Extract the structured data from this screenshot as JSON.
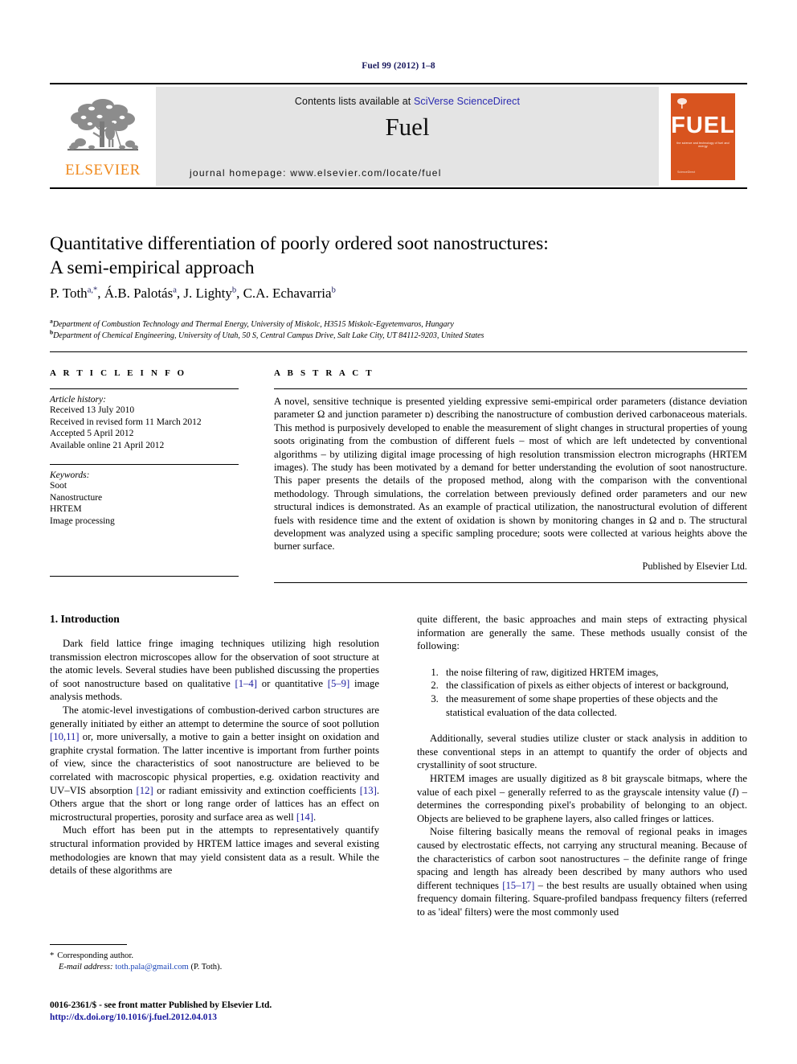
{
  "running_head": "Fuel 99 (2012) 1–8",
  "masthead": {
    "publisher_name": "ELSEVIER",
    "contents_prefix": "Contents lists available at ",
    "contents_link": "SciVerse ScienceDirect",
    "journal_name": "Fuel",
    "homepage": "journal homepage: www.elsevier.com/locate/fuel",
    "cover": {
      "title": "FUEL",
      "subtitle": "the science and technology of fuel and energy",
      "footer": "ScienceDirect"
    }
  },
  "article": {
    "title_line1": "Quantitative differentiation of poorly ordered soot nanostructures:",
    "title_line2": "A semi-empirical approach",
    "authors": [
      {
        "name": "P. Toth",
        "sup": "a,*"
      },
      {
        "name": "Á.B. Palotás",
        "sup": "a"
      },
      {
        "name": "J. Lighty",
        "sup": "b"
      },
      {
        "name": "C.A. Echavarria",
        "sup": "b"
      }
    ],
    "affiliations": [
      {
        "marker": "a",
        "text": "Department of Combustion Technology and Thermal Energy, University of Miskolc, H3515 Miskolc-Egyetemvaros, Hungary"
      },
      {
        "marker": "b",
        "text": "Department of Chemical Engineering, University of Utah, 50 S, Central Campus Drive, Salt Lake City, UT 84112-9203, United States"
      }
    ]
  },
  "info": {
    "label": "A R T I C L E    I N F O",
    "history_title": "Article history:",
    "history": [
      "Received 13 July 2010",
      "Received in revised form 11 March 2012",
      "Accepted 5 April 2012",
      "Available online 21 April 2012"
    ],
    "keywords_title": "Keywords:",
    "keywords": [
      "Soot",
      "Nanostructure",
      "HRTEM",
      "Image processing"
    ]
  },
  "abstract": {
    "label": "A B S T R A C T",
    "text": "A novel, sensitive technique is presented yielding expressive semi-empirical order parameters (distance deviation parameter Ω and junction parameter ᴅ) describing the nanostructure of combustion derived carbonaceous materials. This method is purposively developed to enable the measurement of slight changes in structural properties of young soots originating from the combustion of different fuels – most of which are left undetected by conventional algorithms – by utilizing digital image processing of high resolution transmission electron micrographs (HRTEM images). The study has been motivated by a demand for better understanding the evolution of soot nanostructure. This paper presents the details of the proposed method, along with the comparison with the conventional methodology. Through simulations, the correlation between previously defined order parameters and our new structural indices is demonstrated. As an example of practical utilization, the nanostructural evolution of different fuels with residence time and the extent of oxidation is shown by monitoring changes in Ω and ᴅ. The structural development was analyzed using a specific sampling procedure; soots were collected at various heights above the burner surface.",
    "published_by": "Published by Elsevier Ltd."
  },
  "body": {
    "section_heading": "1. Introduction",
    "left_paragraphs": [
      "Dark field lattice fringe imaging techniques utilizing high resolution transmission electron microscopes allow for the observation of soot structure at the atomic levels. Several studies have been published discussing the properties of soot nanostructure based on qualitative [1–4] or quantitative [5–9] image analysis methods.",
      "The atomic-level investigations of combustion-derived carbon structures are generally initiated by either an attempt to determine the source of soot pollution [10,11] or, more universally, a motive to gain a better insight on oxidation and graphite crystal formation. The latter incentive is important from further points of view, since the characteristics of soot nanostructure are believed to be correlated with macroscopic physical properties, e.g. oxidation reactivity and UV–VIS absorption [12] or radiant emissivity and extinction coefficients [13]. Others argue that the short or long range order of lattices has an effect on microstructural properties, porosity and surface area as well [14].",
      "Much effort has been put in the attempts to representatively quantify structural information provided by HRTEM lattice images and several existing methodologies are known that may yield consistent data as a result. While the details of these algorithms are"
    ],
    "right_intro_paragraph": "quite different, the basic approaches and main steps of extracting physical information are generally the same. These methods usually consist of the following:",
    "numbered_list": [
      "the noise filtering of raw, digitized HRTEM images,",
      "the classification of pixels as either objects of interest or background,",
      "the measurement of some shape properties of these objects and the statistical evaluation of the data collected."
    ],
    "right_paragraphs": [
      "Additionally, several studies utilize cluster or stack analysis in addition to these conventional steps in an attempt to quantify the order of objects and crystallinity of soot structure.",
      "HRTEM images are usually digitized as 8 bit grayscale bitmaps, where the value of each pixel – generally referred to as the grayscale intensity value (I) – determines the corresponding pixel's probability of belonging to an object. Objects are believed to be graphene layers, also called fringes or lattices.",
      "Noise filtering basically means the removal of regional peaks in images caused by electrostatic effects, not carrying any structural meaning. Because of the characteristics of carbon soot nanostructures – the definite range of fringe spacing and length has already been described by many authors who used different techniques [15–17] – the best results are usually obtained when using frequency domain filtering. Square-profiled bandpass frequency filters (referred to as 'ideal' filters) were the most commonly used"
    ]
  },
  "footer": {
    "corresponding_star": "*",
    "corresponding_label": "Corresponding author.",
    "email_label": "E-mail address:",
    "email": "toth.pala@gmail.com",
    "email_suffix": "(P. Toth).",
    "issn_line": "0016-2361/$ - see front matter Published by Elsevier Ltd.",
    "doi": "http://dx.doi.org/10.1016/j.fuel.2012.04.013"
  }
}
